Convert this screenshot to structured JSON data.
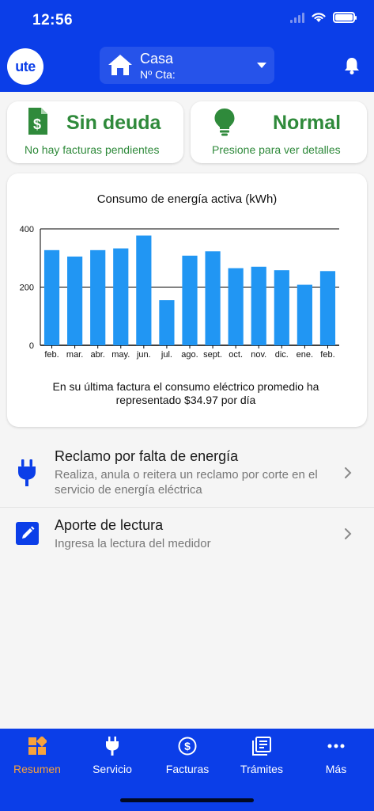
{
  "status": {
    "time": "12:56"
  },
  "header": {
    "logo_text": "ute",
    "account_name": "Casa",
    "account_number_label": "Nº Cta:"
  },
  "summary": {
    "debt": {
      "title": "Sin deuda",
      "subtitle": "No hay facturas pendientes"
    },
    "status": {
      "title": "Normal",
      "subtitle": "Presione para ver detalles"
    }
  },
  "chart_data": {
    "type": "bar",
    "title": "Consumo de energía activa (kWh)",
    "categories": [
      "feb.",
      "mar.",
      "abr.",
      "may.",
      "jun.",
      "jul.",
      "ago.",
      "sept.",
      "oct.",
      "nov.",
      "dic.",
      "ene.",
      "feb."
    ],
    "values": [
      327,
      305,
      327,
      333,
      377,
      155,
      308,
      323,
      265,
      270,
      258,
      208,
      255
    ],
    "yticks": [
      0,
      200,
      400
    ],
    "ylim": [
      0,
      400
    ],
    "color": "#2196f3",
    "grid": true
  },
  "chart_note": "En su última factura el consumo eléctrico promedio ha representado $34.97 por día",
  "menu": [
    {
      "title": "Reclamo por falta de energía",
      "description": "Realiza, anula o reitera un reclamo por corte en el servicio de energía eléctrica"
    },
    {
      "title": "Aporte de lectura",
      "description": "Ingresa la lectura del medidor"
    }
  ],
  "tabs": [
    {
      "label": "Resumen",
      "icon": "grid-icon",
      "active": true
    },
    {
      "label": "Servicio",
      "icon": "plug-icon",
      "active": false
    },
    {
      "label": "Facturas",
      "icon": "dollar-icon",
      "active": false
    },
    {
      "label": "Trámites",
      "icon": "document-icon",
      "active": false
    },
    {
      "label": "Más",
      "icon": "more-icon",
      "active": false
    }
  ],
  "colors": {
    "brand": "#0b3ee8",
    "accent": "#f7a23b",
    "success": "#2f8a3b",
    "bar": "#2196f3"
  }
}
